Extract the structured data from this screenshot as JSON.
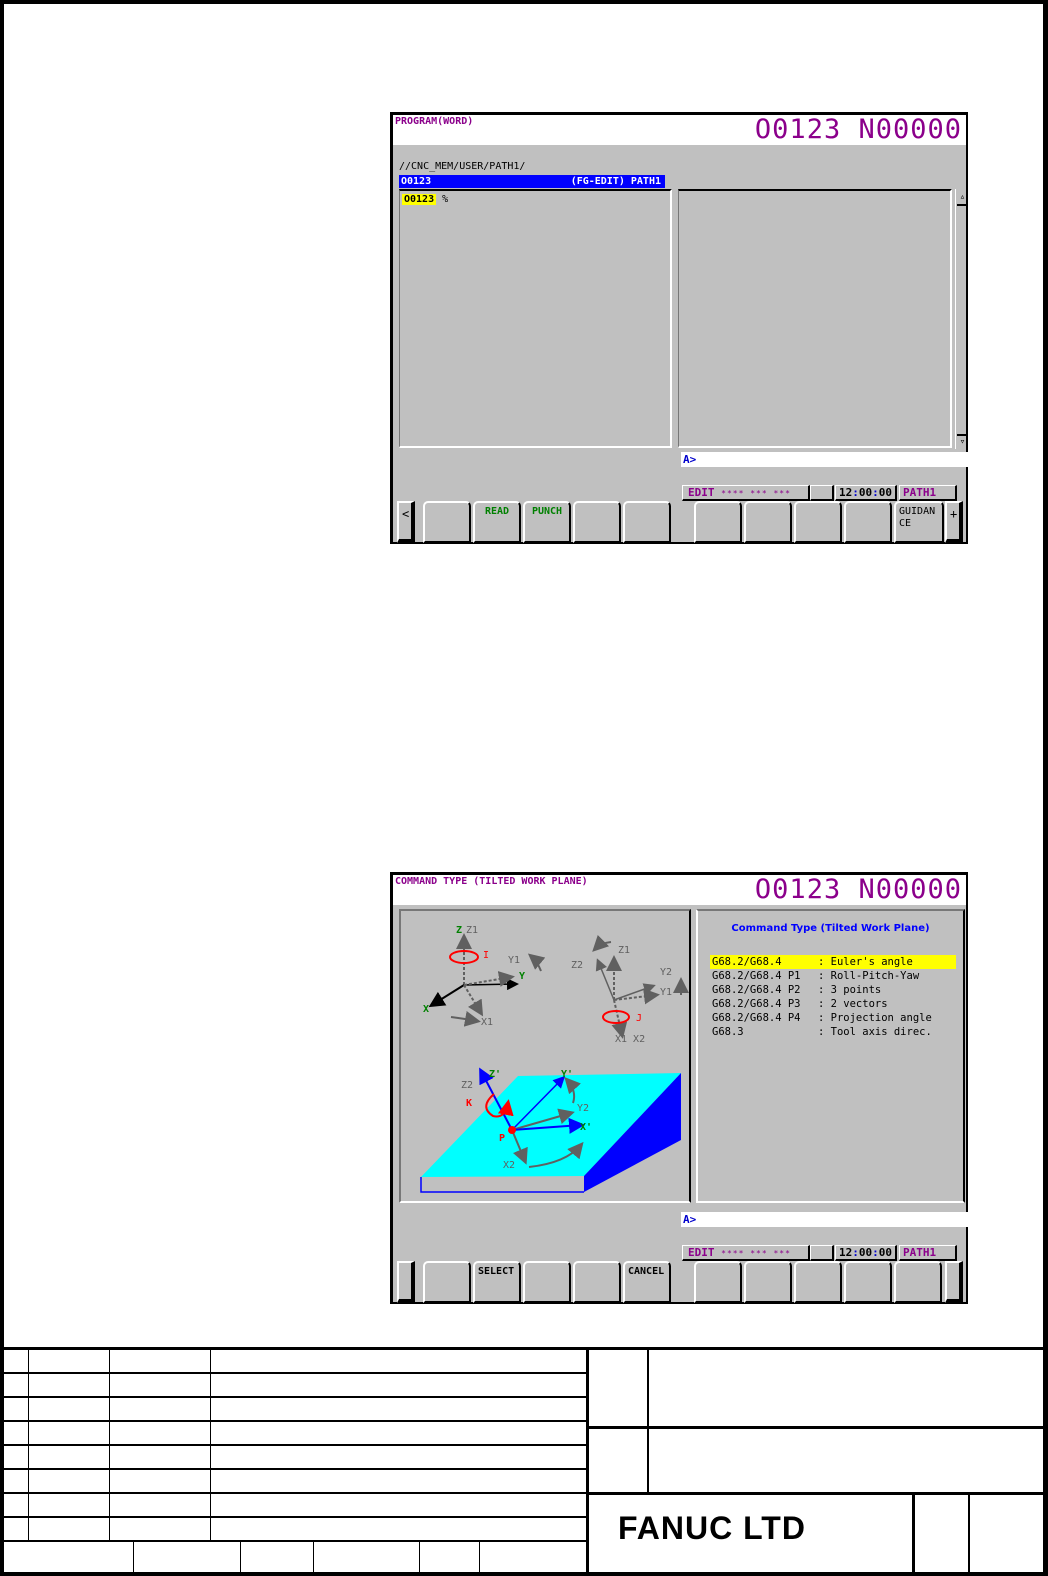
{
  "screen1": {
    "title": "PROGRAM(WORD)",
    "program_number": "O0123 N00000",
    "path_label": "//CNC_MEM/USER/PATH1/",
    "header_left": "O0123",
    "header_right": "(FG-EDIT) PATH1",
    "editor_line_number": "O0123",
    "editor_line_rest": "%",
    "scroll_up": "▵",
    "scroll_down": "▿",
    "input_prompt": "A>",
    "status": {
      "mode": "EDIT",
      "stars": "**** *** ***",
      "time_h": "12",
      "time_m": "00",
      "time_s": "00",
      "path": "PATH1"
    },
    "softkeys": {
      "prev": "<",
      "keys": [
        "",
        "READ",
        "PUNCH",
        "",
        "",
        "",
        "",
        "",
        "",
        "GUIDAN CE"
      ],
      "next": "+"
    }
  },
  "screen2": {
    "title": "COMMAND TYPE (TILTED WORK PLANE)",
    "program_number": "O0123 N00000",
    "diagram_labels": {
      "top_left": {
        "z": "Z",
        "z1": "Z1",
        "i": "I",
        "y1": "Y1",
        "y": "Y",
        "x": "X",
        "x1": "X1"
      },
      "top_right": {
        "z1": "Z1",
        "z2": "Z2",
        "y2": "Y2",
        "y1": "Y1",
        "j": "J",
        "x1x2": "X1 X2"
      },
      "bottom": {
        "z_prime": "Z'",
        "z2": "Z2",
        "k": "K",
        "y_prime": "Y'",
        "y2": "Y2",
        "x_prime": "X'",
        "p": "P",
        "x2": "X2"
      }
    },
    "command_type_title": "Command Type (Tilted Work Plane)",
    "command_types": [
      {
        "code": "G68.2/G68.4",
        "desc": ": Euler's angle",
        "selected": true
      },
      {
        "code": "G68.2/G68.4 P1",
        "desc": ": Roll-Pitch-Yaw",
        "selected": false
      },
      {
        "code": "G68.2/G68.4 P2",
        "desc": ": 3 points",
        "selected": false
      },
      {
        "code": "G68.2/G68.4 P3",
        "desc": ": 2 vectors",
        "selected": false
      },
      {
        "code": "G68.2/G68.4 P4",
        "desc": ": Projection angle",
        "selected": false
      },
      {
        "code": "G68.3",
        "desc": ": Tool axis direc.",
        "selected": false
      }
    ],
    "input_prompt": "A>",
    "status": {
      "mode": "EDIT",
      "stars": "**** *** ***",
      "time_h": "12",
      "time_m": "00",
      "time_s": "00",
      "path": "PATH1"
    },
    "softkeys": {
      "keys": [
        "",
        "SELECT",
        "",
        "",
        "CANCEL",
        "",
        "",
        "",
        "",
        ""
      ]
    }
  },
  "title_block": {
    "company": "FANUC  LTD"
  },
  "colors": {
    "screen_bg": "#c0c0c0",
    "title_magenta": "#8b008b",
    "header_blue": "#0000ff",
    "highlight_yellow": "#ffff00",
    "softkey_green": "#008000",
    "plane_cyan": "#00ffff",
    "plane_side_blue": "#0000ff",
    "rotation_red": "#ff0000"
  }
}
